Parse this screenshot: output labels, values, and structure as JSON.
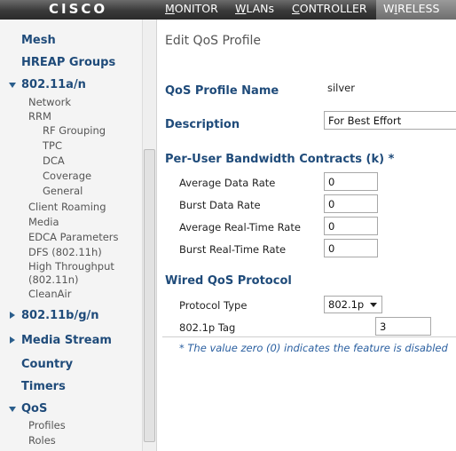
{
  "header": {
    "logo": "CISCO",
    "nav": {
      "monitor_first": "M",
      "monitor_rest": "ONITOR",
      "wlans_first": "W",
      "wlans_rest": "LANs",
      "controller_first": "C",
      "controller_rest": "ONTROLLER",
      "wireless_pre": "W",
      "wireless_ul": "I",
      "wireless_rest": "RELESS"
    }
  },
  "sidebar": {
    "mesh": "Mesh",
    "hreap": "HREAP Groups",
    "a": "802.11a/n",
    "network": "Network",
    "rrm": "RRM",
    "rf_grouping": "RF Grouping",
    "tpc": "TPC",
    "dca": "DCA",
    "coverage": "Coverage",
    "general": "General",
    "client_roaming": "Client Roaming",
    "media": "Media",
    "edca": "EDCA Parameters",
    "dfs": "DFS (802.11h)",
    "ht1": "High Throughput",
    "ht2": "(802.11n)",
    "cleanair": "CleanAir",
    "bgn": "802.11b/g/n",
    "media_stream": "Media Stream",
    "country": "Country",
    "timers": "Timers",
    "qos": "QoS",
    "profiles": "Profiles",
    "roles": "Roles"
  },
  "main": {
    "title": "Edit QoS Profile",
    "profile_name_label": "QoS Profile Name",
    "profile_name_value": "silver",
    "description_label": "Description",
    "description_value": "For Best Effort",
    "per_user_label": "Per-User Bandwidth Contracts (k) *",
    "avg_data_label": "Average Data Rate",
    "avg_data_value": "0",
    "burst_data_label": "Burst Data Rate",
    "burst_data_value": "0",
    "avg_rt_label": "Average Real-Time Rate",
    "avg_rt_value": "0",
    "burst_rt_label": "Burst Real-Time Rate",
    "burst_rt_value": "0",
    "wired_label": "Wired QoS Protocol",
    "protocol_type_label": "Protocol Type",
    "protocol_type_value": "802.1p",
    "tag_label": "802.1p Tag",
    "tag_value": "3",
    "footnote": "* The value zero (0) indicates the feature is disabled"
  },
  "colors": {
    "heading_blue": "#1f4b7a",
    "footnote_blue": "#2a5fa0",
    "topbar": "#3a3a3a",
    "active_tab": "#8a8a8a"
  },
  "icons": {
    "expanded": "triangle-down-icon",
    "collapsed": "triangle-right-icon",
    "dropdown": "chevron-down-icon"
  }
}
